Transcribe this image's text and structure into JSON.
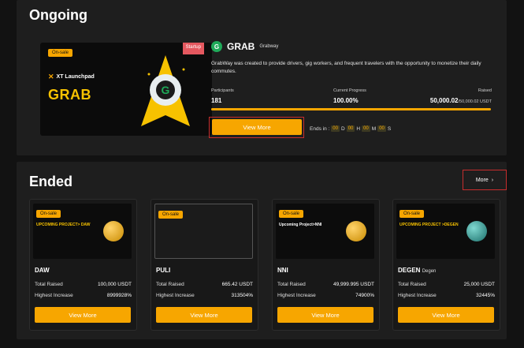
{
  "ongoing": {
    "title": "Ongoing",
    "banner": {
      "badge": "On-sale",
      "tag": "Startup",
      "launchpad": "XT Launchpad",
      "word": "GRAB"
    },
    "project": {
      "logo_letter": "G",
      "name": "GRAB",
      "subtitle": "Grabway",
      "description": "GrabWay was created to provide drivers, gig workers, and frequent travelers with the opportunity to monetize their daily commutes."
    },
    "stats": {
      "participants_label": "Participants",
      "participants": "181",
      "progress_label": "Current Progress",
      "progress_text": "100.00%",
      "progress_fraction": 1.0,
      "raised_label": "Raised",
      "raised": "50,000.02",
      "raised_total": "/50,000.02 USDT"
    },
    "view_more": "View More",
    "countdown": {
      "prefix": "Ends in :",
      "d": "00",
      "d_label": "D",
      "h": "00",
      "h_label": "H",
      "m": "00",
      "m_label": "M",
      "s": "00",
      "s_label": "S"
    }
  },
  "ended": {
    "title": "Ended",
    "more": "More",
    "raised_label": "Total Raised",
    "increase_label": "Highest Increase",
    "button": "View More",
    "cards": [
      {
        "name": "DAW",
        "sub": "",
        "badge": "On-sale",
        "img_text": "UPCOMING PROJECT> DAW",
        "raised": "100,000 USDT",
        "increase": "8999928%"
      },
      {
        "name": "PULI",
        "sub": "",
        "badge": "On-sale",
        "img_text": "",
        "raised": "665.42 USDT",
        "increase": "313504%"
      },
      {
        "name": "NNI",
        "sub": "",
        "badge": "On-sale",
        "img_text": "Upcoming Project>NNI",
        "raised": "49,999.995 USDT",
        "increase": "74900%"
      },
      {
        "name": "DEGEN",
        "sub": "Degen",
        "badge": "On-sale",
        "img_text": "UPCOMING PROJECT >DEGEN",
        "raised": "25,000 USDT",
        "increase": "32445%"
      }
    ]
  },
  "colors": {
    "accent": "#f7a600",
    "highlight": "#c62d2d",
    "panel": "#1e1e1e"
  }
}
